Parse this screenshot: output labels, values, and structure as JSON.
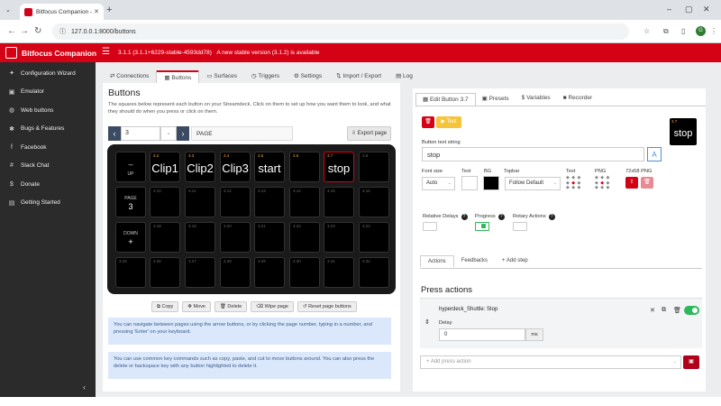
{
  "browser": {
    "tab_title": "Bitfocus Companion - Admin",
    "url": "127.0.0.1:8000/buttons",
    "profile_initial": "G"
  },
  "header": {
    "brand": "Bitfocus Companion",
    "version_text": "3.1.1 (3.1.1+6229-stable-4593dd78)",
    "update_text": "A new stable version (3.1.2) is available",
    "accent": "#d50215"
  },
  "sidebar": {
    "items": [
      {
        "icon": "wand-icon",
        "glyph": "✦",
        "label": "Configuration Wizard"
      },
      {
        "icon": "gamepad-icon",
        "glyph": "▣",
        "label": "Emulator"
      },
      {
        "icon": "web-icon",
        "glyph": "◍",
        "label": "Web buttons"
      },
      {
        "icon": "bug-icon",
        "glyph": "✱",
        "label": "Bugs & Features"
      },
      {
        "icon": "facebook-icon",
        "glyph": "f",
        "label": "Facebook"
      },
      {
        "icon": "slack-icon",
        "glyph": "#",
        "label": "Slack Chat"
      },
      {
        "icon": "dollar-icon",
        "glyph": "$",
        "label": "Donate"
      },
      {
        "icon": "book-icon",
        "glyph": "▤",
        "label": "Getting Started"
      }
    ]
  },
  "topnav": {
    "tabs": [
      {
        "label": "Connections",
        "glyph": "⇄"
      },
      {
        "label": "Buttons",
        "glyph": "▦"
      },
      {
        "label": "Surfaces",
        "glyph": "▭"
      },
      {
        "label": "Triggers",
        "glyph": "◷"
      },
      {
        "label": "Settings",
        "glyph": "⚙"
      },
      {
        "label": "Import / Export",
        "glyph": "⇅"
      },
      {
        "label": "Log",
        "glyph": "▤"
      }
    ]
  },
  "buttons_panel": {
    "title": "Buttons",
    "description": "The squares below represent each button on your Streamdeck. Click on them to set up how you want them to look, and what they should do when you press or click on them.",
    "page_number": "3",
    "page_name": "PAGE",
    "export_label": "Export page",
    "actions": [
      "Copy",
      "Move",
      "Delete",
      "Wipe page",
      "Reset page buttons"
    ],
    "info1": "You can navigate between pages using the arrow buttons, or by clicking the page number, typing in a number, and pressing 'Enter' on your keyboard.",
    "info2": "You can use common key commands such as copy, paste, and cut to move buttons around. You can also press the delete or backspace key with any button highlighted to delete it."
  },
  "grid": {
    "nav": {
      "up_top": "–",
      "up": "UP",
      "page_label": "PAGE",
      "page_value": "3",
      "down": "DOWN",
      "down_bottom": "+"
    },
    "row1": [
      {
        "num": "3.2",
        "label": "Clip1"
      },
      {
        "num": "3.3",
        "label": "Clip2"
      },
      {
        "num": "3.4",
        "label": "Clip3"
      },
      {
        "num": "3.5",
        "label": "start"
      },
      {
        "num": "3.6",
        "label": ""
      },
      {
        "num": "3.7",
        "label": "stop"
      },
      {
        "num": "3.8",
        "label": ""
      }
    ],
    "row2": [
      "3.10",
      "3.11",
      "3.12",
      "3.13",
      "3.14",
      "3.15",
      "3.16"
    ],
    "row3": [
      "3.18",
      "3.19",
      "3.20",
      "3.21",
      "3.22",
      "3.23",
      "3.24"
    ],
    "row4": [
      "3.25",
      "3.26",
      "3.27",
      "3.28",
      "3.29",
      "3.30",
      "3.31",
      "3.32"
    ]
  },
  "edit_panel": {
    "tabs": [
      "Edit Button 3.7",
      "Presets",
      "Variables",
      "Recorder"
    ],
    "test_label": "Test",
    "preview_num": "3.7",
    "preview_text": "stop",
    "text_label": "Button text string",
    "text_value": "stop",
    "font_size_label": "Font size",
    "font_size_value": "Auto",
    "text_color_label": "Text",
    "bg_label": "BG",
    "topbar_label": "Topbar",
    "topbar_value": "Follow Default",
    "text_align_label": "Text",
    "png_label": "PNG",
    "png72_label": "72x58 PNG",
    "relative_delays_label": "Relative Delays",
    "progress_label": "Progress",
    "rotary_label": "Rotary Actions",
    "sub_tabs": [
      "Actions",
      "Feedbacks",
      "+ Add step"
    ],
    "press_title": "Press actions",
    "action_name": "hyperdeck_Shuttle: Stop",
    "delay_label": "Delay",
    "delay_value": "0",
    "delay_unit": "ms",
    "add_placeholder": "+ Add press action"
  }
}
